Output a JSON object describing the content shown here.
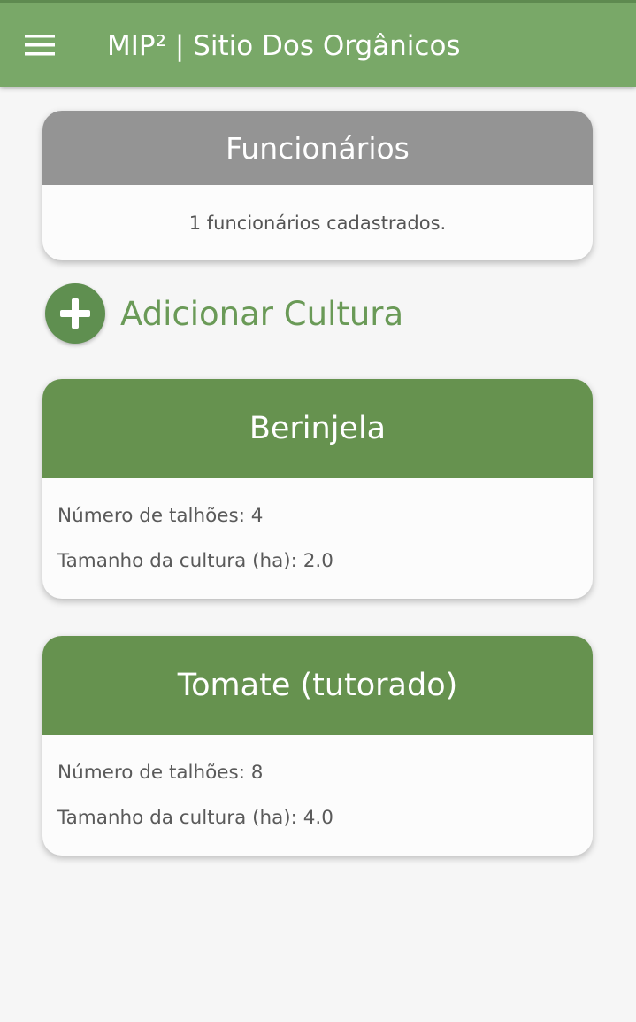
{
  "appbar": {
    "title": "MIP² | Sitio Dos Orgânicos",
    "color": "#79a868"
  },
  "employees": {
    "title": "Funcionários",
    "summary": "1 funcionários cadastrados."
  },
  "add_crop": {
    "label": "Adicionar Cultura",
    "icon": "plus-circle-icon"
  },
  "crops": [
    {
      "name": "Berinjela",
      "plots_text": "Número de talhões: 4",
      "size_text": "Tamanho da cultura (ha): 2.0"
    },
    {
      "name": "Tomate (tutorado)",
      "plots_text": "Número de talhões: 8",
      "size_text": "Tamanho da cultura (ha): 4.0"
    }
  ],
  "colors": {
    "accent": "#66924f",
    "header_gray": "#949494"
  }
}
